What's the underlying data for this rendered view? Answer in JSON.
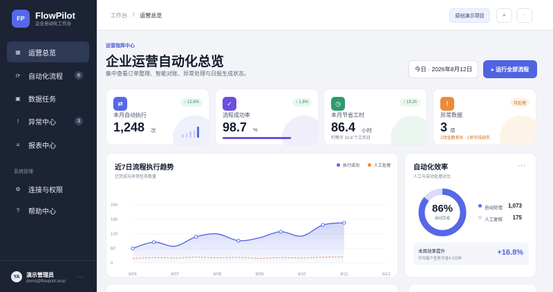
{
  "brand": {
    "logo": "FP",
    "name": "FlowPilot",
    "subtitle": "企业自动化工作台"
  },
  "nav": [
    {
      "label": "运营总览",
      "icon": "grid-icon",
      "glyph": "▦",
      "active": true,
      "badge": ""
    },
    {
      "label": "自动化流程",
      "icon": "flow-icon",
      "glyph": "⟳",
      "active": false,
      "badge": "6"
    },
    {
      "label": "数据任务",
      "icon": "database-icon",
      "glyph": "▣",
      "active": false,
      "badge": ""
    },
    {
      "label": "异常中心",
      "icon": "alert-icon",
      "glyph": "!",
      "active": false,
      "badge": "3"
    },
    {
      "label": "报表中心",
      "icon": "report-icon",
      "glyph": "≡",
      "active": false,
      "badge": ""
    }
  ],
  "nav_section": "系统管理",
  "nav_system": [
    {
      "label": "连接与权限",
      "icon": "link-icon",
      "glyph": "⚙"
    },
    {
      "label": "帮助中心",
      "icon": "help-icon",
      "glyph": "?"
    }
  ],
  "user": {
    "avatar": "YA",
    "name": "演示管理员",
    "email": "demo@flowpilot.local",
    "more": "···"
  },
  "breadcrumb": {
    "parent": "工作台",
    "sep": "/",
    "current": "运营总览"
  },
  "topbar": {
    "primary_label": "原创演示项目",
    "search_glyph": "⌕",
    "notify_glyph": "◌"
  },
  "page": {
    "kicker": "运营指挥中心",
    "title": "企业运营自动化总览",
    "subtitle": "集中查看订单整理、智能对账、异常处理与日报生成状态。"
  },
  "date_chip": "今日 · 2026年8月12日",
  "run_button": "▸ 运行全部流程",
  "kpis": [
    {
      "label": "本月自动执行",
      "value": "1,248",
      "unit": "次",
      "chip": "↑ 12.6%",
      "note": "",
      "icon": "switch-icon",
      "glyph": "⇄",
      "color": "#5568e8",
      "chip_bg": "#e9f7ef",
      "chip_fg": "#2e8c57",
      "deco": "#eef0fb"
    },
    {
      "label": "流程成功率",
      "value": "98.7",
      "unit": "%",
      "chip": "↑ 1.8%",
      "note": "",
      "icon": "check-icon",
      "glyph": "✓",
      "color": "#6c4fe0",
      "chip_bg": "#e9f7ef",
      "chip_fg": "#2e8c57",
      "deco": "#f1eefb",
      "progress": 0.987
    },
    {
      "label": "本月节省工时",
      "value": "86.4",
      "unit": "小时",
      "chip": "↑ 19.2h",
      "note": "约等于 10.8 个工作日",
      "icon": "clock-icon",
      "glyph": "◷",
      "color": "#2f9a6b",
      "chip_bg": "#e9f7ef",
      "chip_fg": "#2e8c57",
      "deco": "#ecf6f1"
    },
    {
      "label": "异常数据",
      "value": "3",
      "unit": "项",
      "chip": "待处理",
      "note": "2项金额差异 · 1项字段缺失",
      "icon": "warning-icon",
      "glyph": "!",
      "color": "#ec8a3a",
      "chip_bg": "#fdf1e3",
      "chip_fg": "#c9731f",
      "deco": "#fdf3e8"
    }
  ],
  "trend": {
    "title": "近7日流程执行趋势",
    "subtitle": "已完成与异常任务数量",
    "legend_a": "执行成功",
    "legend_b": "人工处理",
    "color_a": "#5568e8",
    "color_b": "#ec8a3a"
  },
  "efficiency": {
    "title": "自动化效率",
    "subtitle": "人工与自动处理对比",
    "more": "···",
    "percent": "86%",
    "center_label": "自动完成",
    "auto_label": "自动处理",
    "auto_value": "1,073",
    "manual_label": "人工复核",
    "manual_value": "175",
    "improve_label": "本周效率提升",
    "improve_note": "平均每个任务节省4.2分钟",
    "improve_value": "+16.8%",
    "color_auto": "#5568e8",
    "color_manual": "#d7dbf5",
    "auto_fraction": 0.86
  },
  "chart_data": {
    "type": "line",
    "x": [
      "8/06",
      "8/07",
      "8/08",
      "8/09",
      "8/10",
      "8/11",
      "8/12"
    ],
    "yticks": [
      0,
      60,
      120,
      180,
      240
    ],
    "ylim": [
      0,
      240
    ],
    "series": [
      {
        "name": "执行成功",
        "values": [
          60,
          86,
          69,
          108,
          120,
          92,
          104,
          129,
          111,
          157,
          166
        ]
      },
      {
        "name": "人工处理",
        "values": [
          18,
          22,
          20,
          24,
          21,
          23,
          19,
          22,
          20,
          24,
          25
        ]
      }
    ],
    "point_x": [
      0,
      0.5,
      1,
      1.5,
      2,
      2.5,
      3,
      3.5,
      4,
      4.5,
      5
    ],
    "marker_index": [
      0,
      1,
      3,
      5,
      7,
      9,
      10
    ]
  }
}
